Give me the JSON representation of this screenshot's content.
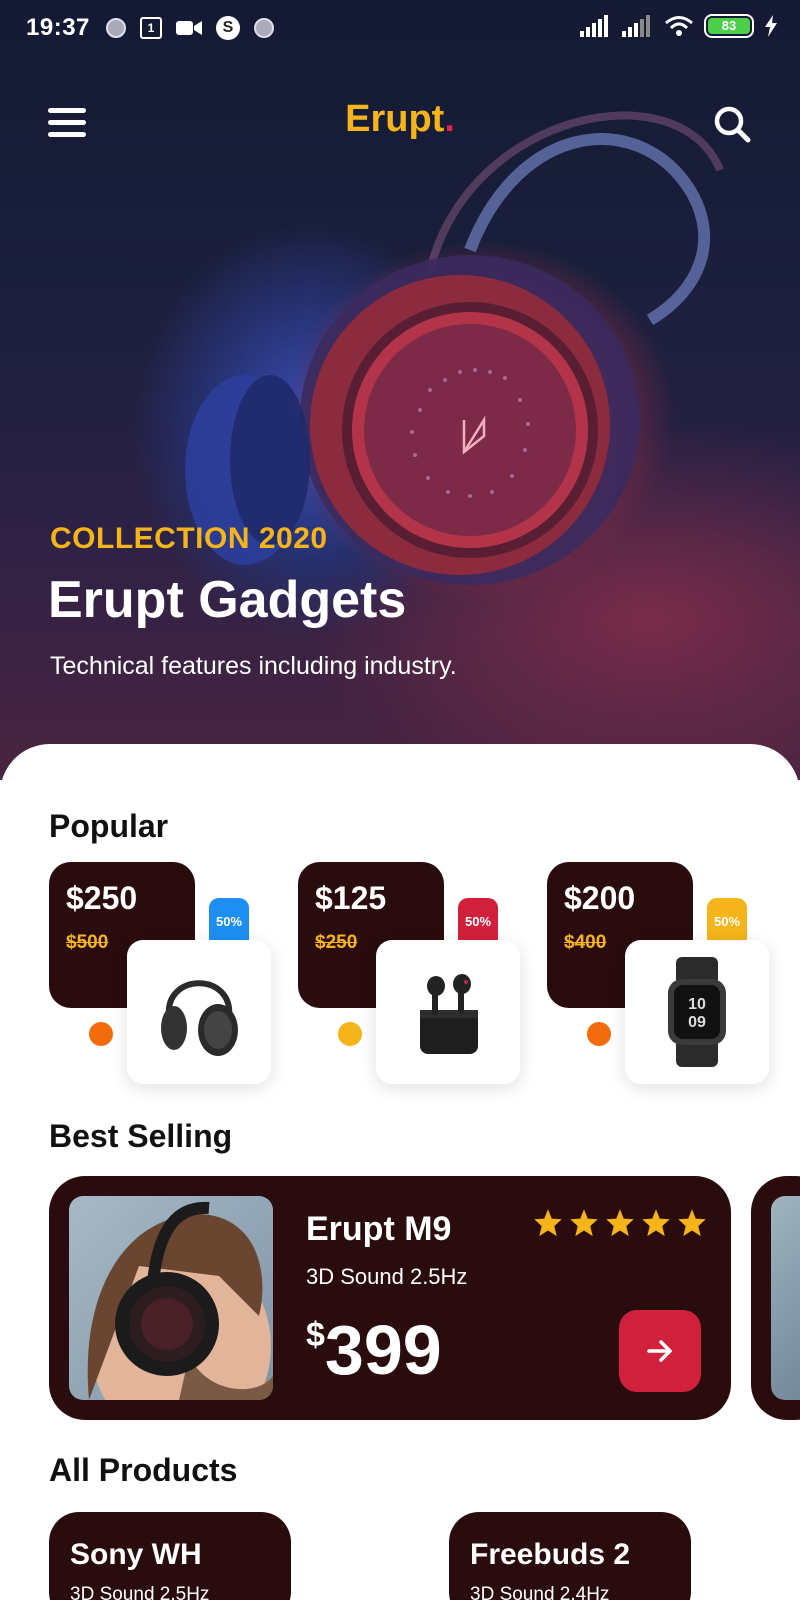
{
  "status_bar": {
    "time": "19:37",
    "calendar_day": "1",
    "battery": "83"
  },
  "header": {
    "logo": "Erupt",
    "logo_dot": "."
  },
  "hero": {
    "eyebrow": "COLLECTION 2020",
    "title": "Erupt Gadgets",
    "subtitle": "Technical features including industry."
  },
  "sections": {
    "popular": "Popular",
    "best_selling": "Best Selling",
    "all_products": "All Products"
  },
  "popular": [
    {
      "price": "$250",
      "old_price": "$500",
      "badge": "50%",
      "badge_color": "#1d8ef2",
      "dot_color": "#f26c0d",
      "product_icon": "headphones-icon"
    },
    {
      "price": "$125",
      "old_price": "$250",
      "badge": "50%",
      "badge_color": "#d1203c",
      "dot_color": "#f4b41a",
      "product_icon": "earbuds-icon"
    },
    {
      "price": "$200",
      "old_price": "$400",
      "badge": "50%",
      "badge_color": "#f4b41a",
      "dot_color": "#f26c0d",
      "product_icon": "smartwatch-icon"
    }
  ],
  "best_selling": {
    "name": "Erupt M9",
    "spec": "3D Sound 2.5Hz",
    "currency": "$",
    "price": "399",
    "rating": 5
  },
  "all_products": [
    {
      "name": "Sony WH",
      "spec": "3D Sound 2.5Hz"
    },
    {
      "name": "Freebuds 2",
      "spec": "3D Sound 2.4Hz"
    }
  ],
  "colors": {
    "accent": "#f4b41a",
    "card": "#2a0c0f",
    "red": "#d1203c"
  }
}
